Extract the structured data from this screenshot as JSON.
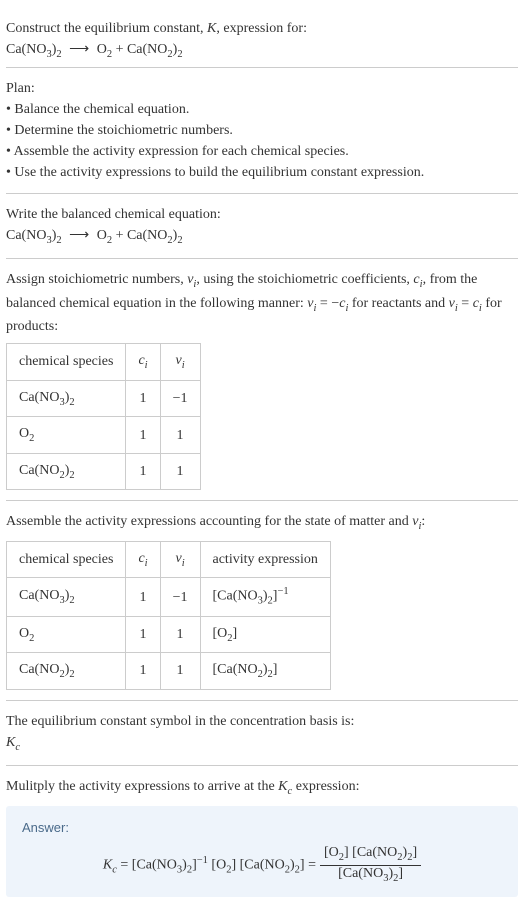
{
  "header": {
    "prompt_line1": "Construct the equilibrium constant, ",
    "K": "K",
    "prompt_line1b": ", expression for:"
  },
  "reaction": {
    "reactant1": "Ca(NO",
    "reactant1_sub1": "3",
    "reactant1_close": ")",
    "reactant1_sub2": "2",
    "arrow": "⟶",
    "product1": "O",
    "product1_sub": "2",
    "plus": " + ",
    "product2": "Ca(NO",
    "product2_sub1": "2",
    "product2_close": ")",
    "product2_sub2": "2"
  },
  "plan": {
    "title": "Plan:",
    "items": [
      "Balance the chemical equation.",
      "Determine the stoichiometric numbers.",
      "Assemble the activity expression for each chemical species.",
      "Use the activity expressions to build the equilibrium constant expression."
    ]
  },
  "balanced_intro": "Write the balanced chemical equation:",
  "stoich_intro": {
    "part1": "Assign stoichiometric numbers, ",
    "nu_i": "ν",
    "i": "i",
    "part2": ", using the stoichiometric coefficients, ",
    "c_i": "c",
    "part3": ", from the balanced chemical equation in the following manner: ",
    "eq1a": "ν",
    "eq1b": " = −",
    "eq1c": "c",
    "part4": " for reactants and ",
    "eq2a": "ν",
    "eq2b": " = ",
    "eq2c": "c",
    "part5": " for products:"
  },
  "table1": {
    "h1": "chemical species",
    "h2": "c",
    "h2_sub": "i",
    "h3": "ν",
    "h3_sub": "i",
    "rows": [
      {
        "species_a": "Ca(NO",
        "s1": "3",
        "species_b": ")",
        "s2": "2",
        "c": "1",
        "nu": "−1"
      },
      {
        "species_a": "O",
        "s1": "2",
        "species_b": "",
        "s2": "",
        "c": "1",
        "nu": "1"
      },
      {
        "species_a": "Ca(NO",
        "s1": "2",
        "species_b": ")",
        "s2": "2",
        "c": "1",
        "nu": "1"
      }
    ]
  },
  "activity_intro": {
    "part1": "Assemble the activity expressions accounting for the state of matter and ",
    "nu": "ν",
    "i": "i",
    "part2": ":"
  },
  "table2": {
    "h1": "chemical species",
    "h2": "c",
    "h2_sub": "i",
    "h3": "ν",
    "h3_sub": "i",
    "h4": "activity expression",
    "rows": [
      {
        "species_a": "Ca(NO",
        "s1": "3",
        "species_b": ")",
        "s2": "2",
        "c": "1",
        "nu": "−1",
        "act_a": "[Ca(NO",
        "as1": "3",
        "act_b": ")",
        "as2": "2",
        "act_c": "]",
        "exp": "−1"
      },
      {
        "species_a": "O",
        "s1": "2",
        "species_b": "",
        "s2": "",
        "c": "1",
        "nu": "1",
        "act_a": "[O",
        "as1": "2",
        "act_b": "",
        "as2": "",
        "act_c": "]",
        "exp": ""
      },
      {
        "species_a": "Ca(NO",
        "s1": "2",
        "species_b": ")",
        "s2": "2",
        "c": "1",
        "nu": "1",
        "act_a": "[Ca(NO",
        "as1": "2",
        "act_b": ")",
        "as2": "2",
        "act_c": "]",
        "exp": ""
      }
    ]
  },
  "kc_intro": {
    "part1": "The equilibrium constant symbol in the concentration basis is:",
    "K": "K",
    "c": "c"
  },
  "multiply_intro": {
    "part1": "Mulitply the activity expressions to arrive at the ",
    "K": "K",
    "c": "c",
    "part2": " expression:"
  },
  "answer": {
    "label": "Answer:",
    "Kc_K": "K",
    "Kc_c": "c",
    "eq": " = ",
    "t1a": "[Ca(NO",
    "t1s1": "3",
    "t1b": ")",
    "t1s2": "2",
    "t1c": "]",
    "exp1": "−1",
    "t2a": " [O",
    "t2s1": "2",
    "t2c": "] ",
    "t3a": "[Ca(NO",
    "t3s1": "2",
    "t3b": ")",
    "t3s2": "2",
    "t3c": "]",
    "eq2": " = ",
    "num_a": "[O",
    "num_s1": "2",
    "num_b": "] [Ca(NO",
    "num_s2": "2",
    "num_c": ")",
    "num_s3": "2",
    "num_d": "]",
    "den_a": "[Ca(NO",
    "den_s1": "3",
    "den_b": ")",
    "den_s2": "2",
    "den_c": "]"
  }
}
